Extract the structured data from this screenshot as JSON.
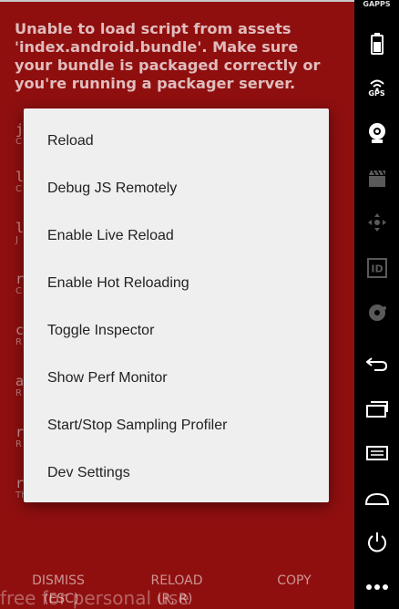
{
  "error": {
    "message": "Unable to load script from assets 'index.android.bundle'. Make sure your bundle is packaged correctly or you're running a packager server."
  },
  "stack_frames": [
    {
      "method": "j",
      "file": "C"
    },
    {
      "method": "l",
      "file": "C"
    },
    {
      "method": "l",
      "file": "J"
    },
    {
      "method": "r",
      "file": "C"
    },
    {
      "method": "c",
      "file": "R"
    },
    {
      "method": "a",
      "file": "R"
    },
    {
      "method": "r",
      "file": "R"
    },
    {
      "method": "r",
      "file": "Th"
    }
  ],
  "dev_menu": {
    "items": [
      "Reload",
      "Debug JS Remotely",
      "Enable Live Reload",
      "Enable Hot Reloading",
      "Toggle Inspector",
      "Show Perf Monitor",
      "Start/Stop Sampling Profiler",
      "Dev Settings"
    ]
  },
  "bottom_buttons": {
    "dismiss": {
      "label": "DISMISS",
      "sub": "(ESC)"
    },
    "reload": {
      "label": "RELOAD",
      "sub": "(R, R)"
    },
    "copy": {
      "label": "COPY"
    }
  },
  "watermark": "free for personal use",
  "toolbar": {
    "gapps_label": "GAPPS",
    "gps_label": "GPS",
    "icons": [
      "battery-icon",
      "gps-icon",
      "camera-icon",
      "video-icon",
      "dpad-icon",
      "id-icon",
      "disk-icon",
      "back-icon",
      "recent-apps-icon",
      "menu-icon",
      "home-icon",
      "power-icon",
      "more-icon"
    ]
  },
  "colors": {
    "error_background": "#8f0f0f",
    "dialog_background": "#efefef",
    "toolbar_background": "#000000"
  }
}
